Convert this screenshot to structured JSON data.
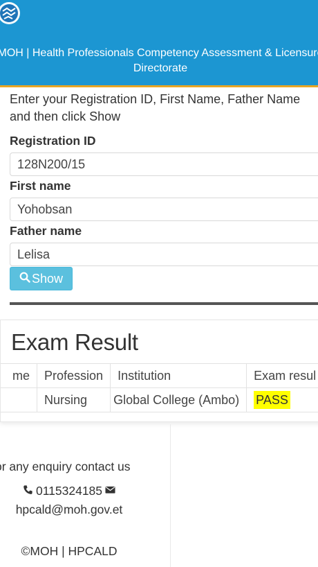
{
  "header": {
    "title": "MOH | Health Professionals Competency Assessment & Licensure Directorate"
  },
  "form": {
    "instruction": "Enter your Registration ID, First Name, Father Name and then click Show",
    "registration_label": "Registration ID",
    "registration_value": "128N200/15",
    "first_name_label": "First name",
    "first_name_value": "Yohobsan",
    "father_name_label": "Father name",
    "father_name_value": "Lelisa",
    "show_label": "Show"
  },
  "result": {
    "title": "Exam Result",
    "columns": [
      "me",
      "Profession",
      "Institution",
      "Exam resul"
    ],
    "rows": [
      {
        "name": "",
        "profession": "Nursing",
        "institution": "Global College (Ambo)",
        "exam_result": "PASS"
      }
    ],
    "pass_color": "#ffff00"
  },
  "footer": {
    "enquiry": "or any enquiry contact us",
    "phone": "0115324185",
    "email": "hpcald@moh.gov.et",
    "copyright": "©MOH | HPCALD",
    "icons": [
      "phone-icon",
      "envelope-icon"
    ]
  },
  "colors": {
    "header_bg": "#1c96d2",
    "header_accent": "#e9a623",
    "button_bg": "#5bc0de"
  }
}
